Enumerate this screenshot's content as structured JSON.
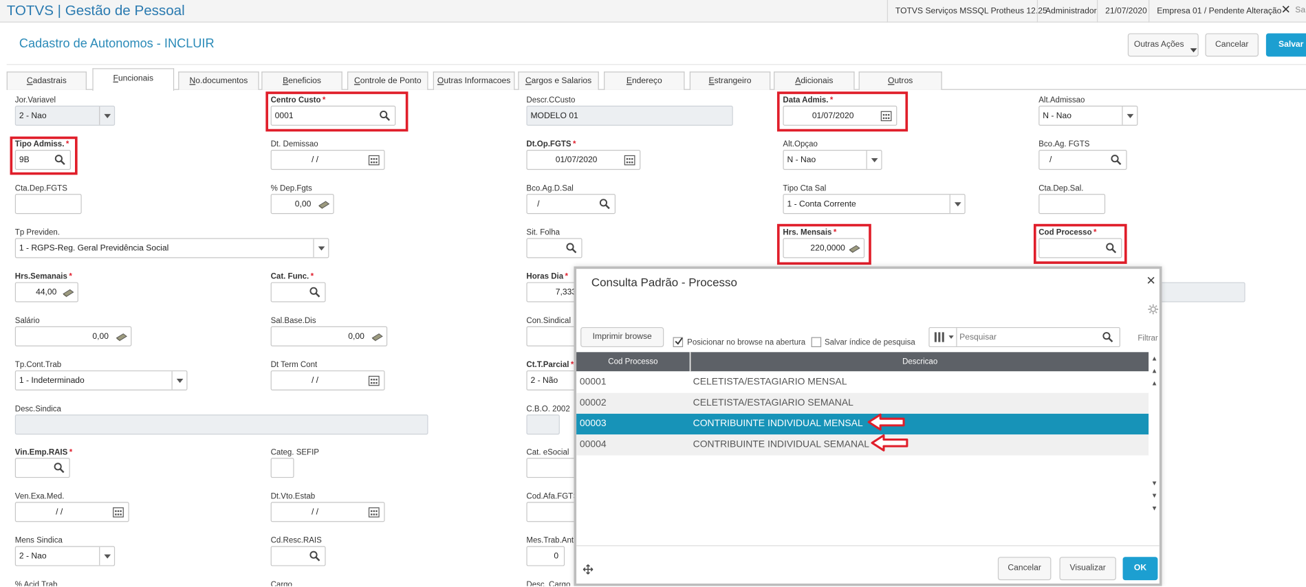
{
  "topbar": {
    "brand": "TOTVS | Gestão de Pessoal",
    "server": "TOTVS Serviços MSSQL Protheus 12.25",
    "user": "Administrador",
    "date": "21/07/2020",
    "company": "Empresa 01 / Pendente Alteração",
    "truncated": "Sa"
  },
  "header": {
    "title": "Cadastro de Autonomos - INCLUIR",
    "more_actions": "Outras Ações",
    "cancel": "Cancelar",
    "save": "Salvar"
  },
  "tabs": [
    {
      "label": "Cadastrais",
      "ul": "C",
      "rest": "adastrais"
    },
    {
      "label": "Funcionais",
      "ul": "F",
      "rest": "uncionais"
    },
    {
      "label": "No.documentos",
      "ul": "N",
      "rest": "o.documentos"
    },
    {
      "label": "Beneficios",
      "ul": "B",
      "rest": "eneficios"
    },
    {
      "label": "Controle de Ponto",
      "ul": "C",
      "rest": "ontrole de Ponto"
    },
    {
      "label": "Outras Informacoes",
      "ul": "O",
      "rest": "utras Informacoes"
    },
    {
      "label": "Cargos e Salarios",
      "ul": "C",
      "rest": "argos e Salarios"
    },
    {
      "label": "Endereço",
      "ul": "E",
      "rest": "ndereço"
    },
    {
      "label": "Estrangeiro",
      "ul": "E",
      "rest": "strangeiro"
    },
    {
      "label": "Adicionais",
      "ul": "A",
      "rest": "dicionais"
    },
    {
      "label": "Outros",
      "ul": "O",
      "rest": "utros"
    }
  ],
  "form": {
    "jor_variavel": {
      "label": "Jor.Variavel",
      "value": "2 - Nao"
    },
    "centro_custo": {
      "label": "Centro Custo",
      "value": "0001"
    },
    "descr_ccusto": {
      "label": "Descr.CCusto",
      "value": "MODELO 01"
    },
    "data_admis": {
      "label": "Data Admis.",
      "value": "01/07/2020"
    },
    "alt_admissao": {
      "label": "Alt.Admissao",
      "value": "N - Nao"
    },
    "tipo_admiss": {
      "label": "Tipo Admiss.",
      "value": "9B"
    },
    "dt_demissao": {
      "label": "Dt. Demissao",
      "value": "/ /"
    },
    "dt_op_fgts": {
      "label": "Dt.Op.FGTS",
      "value": "01/07/2020"
    },
    "alt_opcao": {
      "label": "Alt.Opçao",
      "value": "N - Nao"
    },
    "bco_ag_fgts": {
      "label": "Bco.Ag. FGTS",
      "value": "/"
    },
    "cta_dep_fgts": {
      "label": "Cta.Dep.FGTS",
      "value": ""
    },
    "pct_dep_fgts": {
      "label": "% Dep.Fgts",
      "value": "0,00"
    },
    "bco_ag_d_sal": {
      "label": "Bco.Ag.D.Sal",
      "value": "/"
    },
    "tipo_cta_sal": {
      "label": "Tipo Cta Sal",
      "value": "1 - Conta Corrente"
    },
    "cta_dep_sal": {
      "label": "Cta.Dep.Sal.",
      "value": ""
    },
    "tp_previden": {
      "label": "Tp Previden.",
      "value": "1 - RGPS-Reg. Geral Previdência Social"
    },
    "sit_folha": {
      "label": "Sit. Folha",
      "value": ""
    },
    "hrs_mensais": {
      "label": "Hrs. Mensais",
      "value": "220,0000"
    },
    "cod_processo": {
      "label": "Cod Processo",
      "value": ""
    },
    "hrs_semanais": {
      "label": "Hrs.Semanais",
      "value": "44,00"
    },
    "cat_func": {
      "label": "Cat. Func.",
      "value": ""
    },
    "horas_dia": {
      "label": "Horas Dia",
      "value": "7,333"
    },
    "salario": {
      "label": "Salário",
      "value": "0,00"
    },
    "sal_base_dis": {
      "label": "Sal.Base.Dis",
      "value": "0,00"
    },
    "con_sindical": {
      "label": "Con.Sindical"
    },
    "tp_cont_trab": {
      "label": "Tp.Cont.Trab",
      "value": "1 - Indeterminado"
    },
    "dt_term_cont": {
      "label": "Dt Term Cont",
      "value": "/ /"
    },
    "ct_t_parcial": {
      "label": "Ct.T.Parcial",
      "value": "2 - Não"
    },
    "desc_sindica": {
      "label": "Desc.Sindica"
    },
    "cbo_2002": {
      "label": "C.B.O. 2002"
    },
    "vin_emp_rais": {
      "label": "Vin.Emp.RAIS",
      "value": ""
    },
    "categ_sefip": {
      "label": "Categ. SEFIP",
      "value": ""
    },
    "cat_esocial": {
      "label": "Cat. eSocial"
    },
    "ven_exa_med": {
      "label": "Ven.Exa.Med.",
      "value": "/ /"
    },
    "dt_vto_estab": {
      "label": "Dt.Vto.Estab",
      "value": "/ /"
    },
    "cod_afa_fgts": {
      "label": "Cod.Afa.FGTS"
    },
    "mens_sindica": {
      "label": "Mens Sindica",
      "value": "2 - Nao"
    },
    "cd_resc_rais": {
      "label": "Cd.Resc.RAIS",
      "value": ""
    },
    "mes_trab_ant": {
      "label": "Mes.Trab.Ant",
      "value": "0"
    },
    "pct_acid_trab": {
      "label": "% Acid.Trab"
    },
    "cargo": {
      "label": "Cargo"
    },
    "desc_cargo": {
      "label": "Desc. Cargo"
    }
  },
  "dialog": {
    "title": "Consulta Padrão - Processo",
    "print_button": "Imprimir browse",
    "position_check": "Posicionar no browse na abertura",
    "position_checked": true,
    "save_index_check": "Salvar índice de pesquisa",
    "save_index_checked": false,
    "search_placeholder": "Pesquisar",
    "filter": "Filtrar",
    "columns": [
      "Cod Processo",
      "Descricao"
    ],
    "rows": [
      {
        "code": "00001",
        "desc": "CELETISTA/ESTAGIARIO MENSAL"
      },
      {
        "code": "00002",
        "desc": "CELETISTA/ESTAGIARIO SEMANAL"
      },
      {
        "code": "00003",
        "desc": "CONTRIBUINTE INDIVIDUAL MENSAL"
      },
      {
        "code": "00004",
        "desc": "CONTRIBUINTE INDIVIDUAL SEMANAL"
      }
    ],
    "selected_row": 2,
    "cancel": "Cancelar",
    "view": "Visualizar",
    "ok": "OK"
  },
  "colors": {
    "brand": "#2a7ab0",
    "title": "#2a8ab8",
    "primary": "#1c9fd1",
    "highlight": "#e01e2a",
    "grid_header": "#5d6167",
    "row_selected": "#1793b8"
  }
}
